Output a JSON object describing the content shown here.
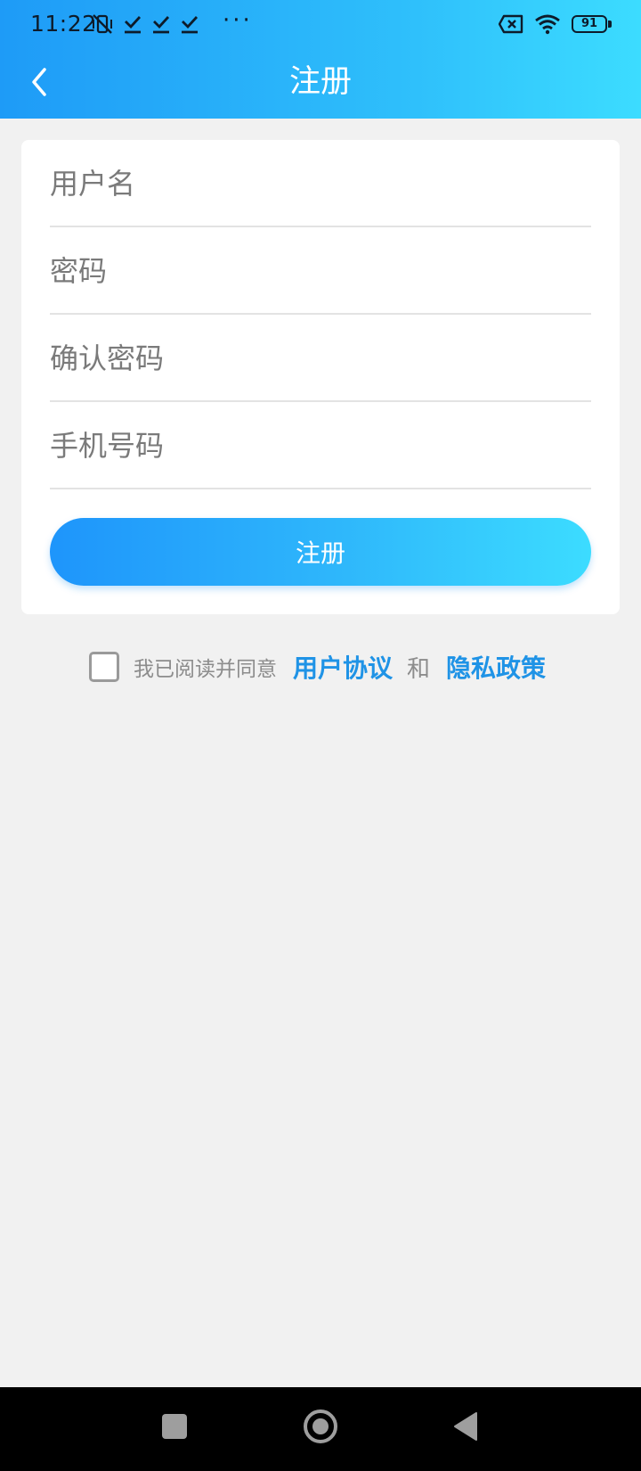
{
  "status_bar": {
    "time": "11:22",
    "more": "···",
    "battery_level": "91",
    "icons": [
      "vibrate-off-icon",
      "download-done-icon",
      "download-done-icon",
      "download-done-icon",
      "sim-error-icon",
      "wifi-icon",
      "battery-icon"
    ]
  },
  "header": {
    "title": "注册",
    "back_icon": "back-chevron-icon"
  },
  "form": {
    "username_placeholder": "用户名",
    "password_placeholder": "密码",
    "confirm_password_placeholder": "确认密码",
    "phone_placeholder": "手机号码",
    "submit_label": "注册"
  },
  "agreement": {
    "checked": false,
    "prefix": "我已阅读并同意",
    "user_agreement": "用户协议",
    "and": "和",
    "privacy_policy": "隐私政策"
  },
  "colors": {
    "accent": "#1e9bf7",
    "accent_light": "#3cdcff",
    "link": "#1f93e6",
    "background": "#f1f1f1"
  },
  "system_nav": {
    "icons": [
      "recent-apps-icon",
      "home-icon",
      "back-triangle-icon"
    ]
  }
}
